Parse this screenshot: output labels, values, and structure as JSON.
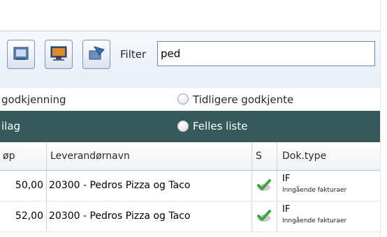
{
  "toolbar": {
    "buttons": [
      {
        "icon": "export-icon"
      },
      {
        "icon": "monitor-icon"
      },
      {
        "icon": "send-icon"
      }
    ],
    "filter_label": "Filter",
    "filter_value": "ped"
  },
  "view_options": {
    "left_text": "godkjenning",
    "right_text": "Tidligere godkjente"
  },
  "band": {
    "left_text": "ilag",
    "right_text": "Felles liste"
  },
  "table": {
    "headers": [
      "øp",
      "Leverandørnavn",
      "S",
      "Dok.type"
    ],
    "rows": [
      {
        "amount": "50,00",
        "supplier": "20300 - Pedros Pizza og Taco",
        "status_icon": "check-icon",
        "doc_code": "IF",
        "doc_desc": "Inngående fakturaer"
      },
      {
        "amount": "52,00",
        "supplier": "20300 - Pedros Pizza og Taco",
        "status_icon": "check-icon",
        "doc_code": "IF",
        "doc_desc": "Inngående fakturaer"
      }
    ]
  },
  "colors": {
    "band": "#365a5a",
    "toolbar_top": "#f6f9fd",
    "toolbar_bottom": "#e7eef7",
    "input_border": "#6d87a8"
  }
}
